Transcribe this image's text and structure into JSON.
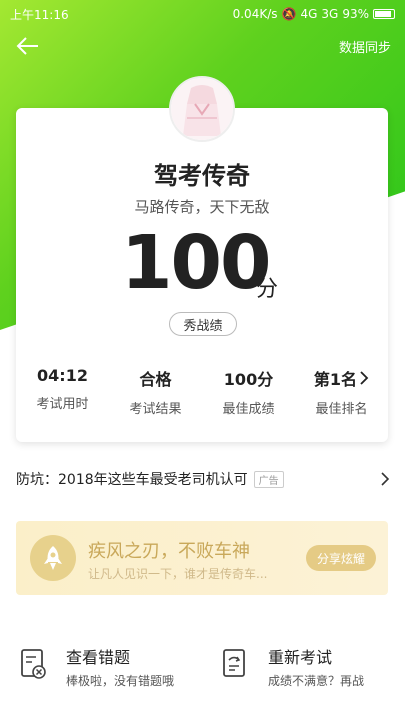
{
  "status": {
    "time": "上午11:16",
    "network": "0.04K/s",
    "signal1": "4G",
    "signal2": "3G",
    "battery": "93%"
  },
  "nav": {
    "back_icon": "arrow-left-icon",
    "sync_label": "数据同步"
  },
  "card": {
    "title": "驾考传奇",
    "subtitle": "马路传奇，天下无敌",
    "score": "100",
    "score_unit": "分",
    "show_button": "秀战绩",
    "stats": [
      {
        "value": "04:12",
        "label": "考试用时"
      },
      {
        "value": "合格",
        "label": "考试结果"
      },
      {
        "value": "100分",
        "label": "最佳成绩"
      },
      {
        "value": "第1名",
        "label": "最佳排名"
      }
    ]
  },
  "ad": {
    "text": "防坑：2018年这些车最受老司机认可",
    "tag": "广告"
  },
  "banner": {
    "title": "疾风之刃，不败车神",
    "subtitle": "让凡人见识一下，谁才是传奇车...",
    "share_button": "分享炫耀"
  },
  "actions": [
    {
      "title": "查看错题",
      "subtitle": "棒极啦，没有错题哦",
      "icon": "wrong-questions-icon"
    },
    {
      "title": "重新考试",
      "subtitle": "成绩不满意？再战",
      "icon": "retake-exam-icon"
    }
  ],
  "colors": {
    "green_light": "#a4e832",
    "green_dark": "#23c41a",
    "gold": "#c9a85a"
  }
}
